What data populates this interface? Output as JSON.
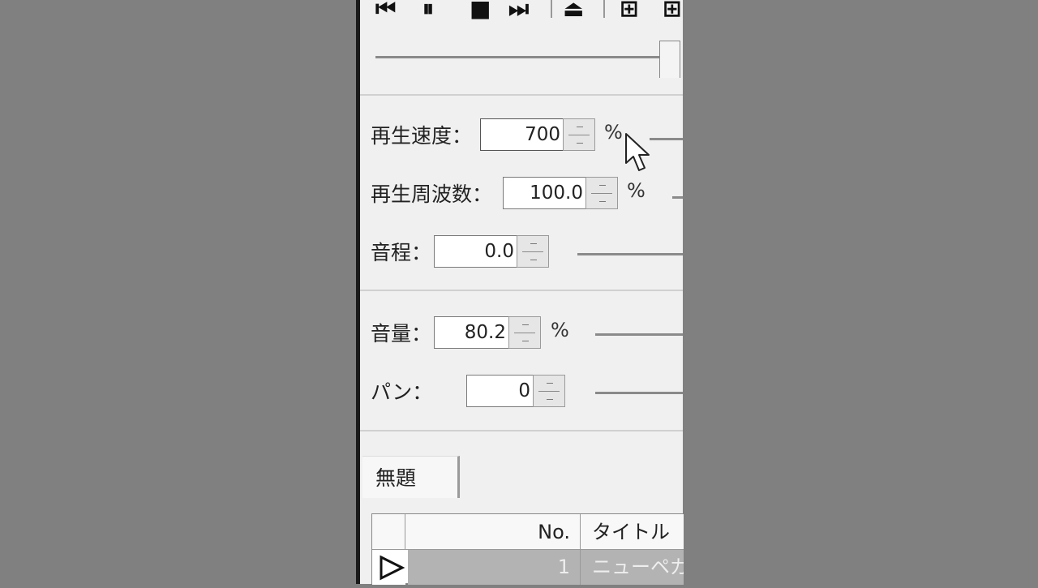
{
  "toolbar": {
    "icons": [
      "skip-back",
      "pause",
      "stop",
      "skip-forward",
      "eject",
      "add-file",
      "add-folder"
    ]
  },
  "controls": {
    "speed": {
      "label": "再生速度：",
      "value": "700",
      "unit": "%"
    },
    "frequency": {
      "label": "再生周波数：",
      "value": "100.0",
      "unit": "%"
    },
    "pitch": {
      "label": "音程：",
      "value": "0.0"
    },
    "volume": {
      "label": "音量：",
      "value": "80.2",
      "unit": "%"
    },
    "pan": {
      "label": "パン：",
      "value": "0"
    }
  },
  "playlist": {
    "tab_label": "無題",
    "columns": {
      "no": "No.",
      "title": "タイトル"
    },
    "rows": [
      {
        "no": "1",
        "title": "ニューペガ"
      }
    ]
  }
}
